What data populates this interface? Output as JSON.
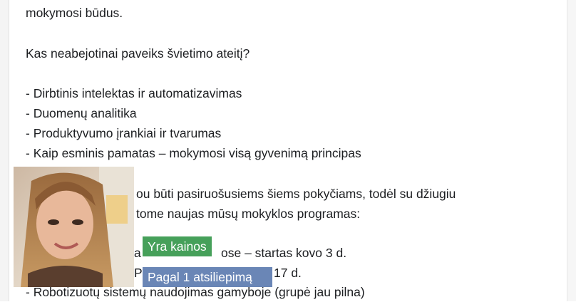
{
  "post": {
    "line_partial": "mokymosi būdus.",
    "question": "Kas neabejotinai paveiks švietimo ateitį?",
    "bullets": [
      "- Dirbtinis intelektas ir automatizavimas",
      "- Duomenų analitika",
      "- Produktyvumo įrankiai ir tvarumas",
      "- Kaip esminis pamatas – mokymosi visą gyvenimą principas"
    ],
    "para_line1": "ou būti pasiruošusiems šiems pokyčiams, todėl su džiugiu",
    "para_line2": "tome naujas mūsų mokyklos programas:",
    "program1": "a",
    "program1_tail": "ose – startas kovo 3 d.",
    "program2_head": "P",
    "program2_tail": "17 d.",
    "program3": "- Robotizuotų sistemų naudojimas gamyboje (grupė jau pilna)"
  },
  "tags": {
    "price": "Yra kainos",
    "rating": "Pagal 1 atsiliepimą"
  },
  "colors": {
    "price_tag": "#46a05a",
    "rating_tag": "#6a86b6"
  }
}
